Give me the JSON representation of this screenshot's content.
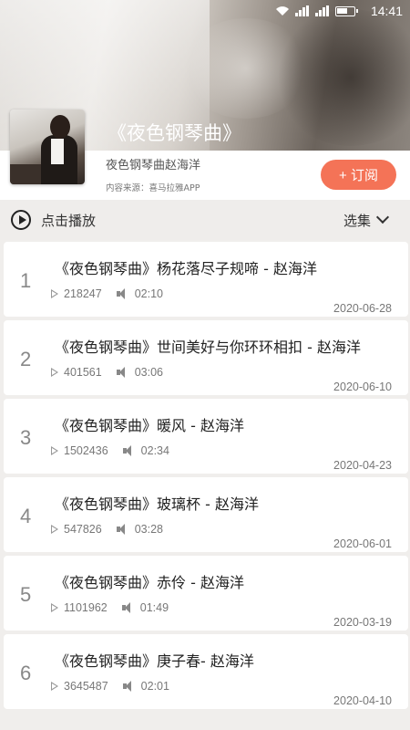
{
  "status": {
    "time": "14:41"
  },
  "album": {
    "title": "《夜色钢琴曲》",
    "subtitle": "夜色钢琴曲赵海洋",
    "source": "内容来源：喜马拉雅APP",
    "subscribe_label": "+ 订阅"
  },
  "controls": {
    "play_label": "点击播放",
    "select_label": "选集"
  },
  "tracks": [
    {
      "index": "1",
      "title": "《夜色钢琴曲》杨花落尽子规啼 - 赵海洋",
      "plays": "218247",
      "duration": "02:10",
      "date": "2020-06-28"
    },
    {
      "index": "2",
      "title": "《夜色钢琴曲》世间美好与你环环相扣 - 赵海洋",
      "plays": "401561",
      "duration": "03:06",
      "date": "2020-06-10"
    },
    {
      "index": "3",
      "title": "《夜色钢琴曲》暖风 - 赵海洋",
      "plays": "1502436",
      "duration": "02:34",
      "date": "2020-04-23"
    },
    {
      "index": "4",
      "title": "《夜色钢琴曲》玻璃杯 - 赵海洋",
      "plays": "547826",
      "duration": "03:28",
      "date": "2020-06-01"
    },
    {
      "index": "5",
      "title": "《夜色钢琴曲》赤伶 - 赵海洋",
      "plays": "1101962",
      "duration": "01:49",
      "date": "2020-03-19"
    },
    {
      "index": "6",
      "title": "《夜色钢琴曲》庚子春- 赵海洋",
      "plays": "3645487",
      "duration": "02:01",
      "date": "2020-04-10"
    }
  ]
}
